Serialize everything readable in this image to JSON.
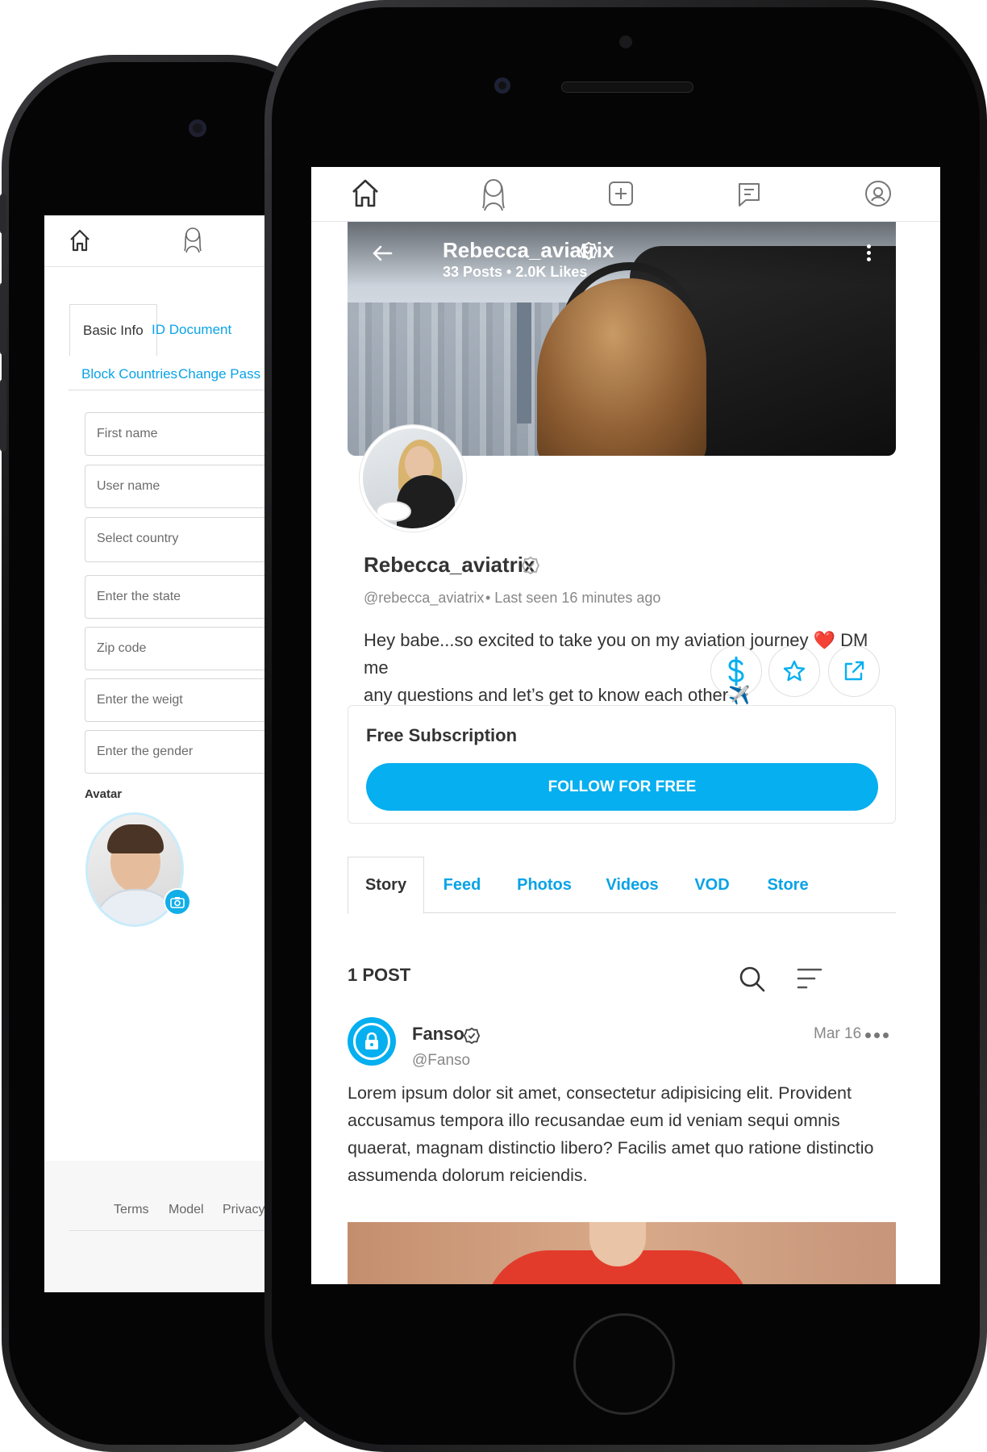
{
  "back_phone": {
    "tabs": [
      "Basic Info",
      "ID Document",
      "Block Countries",
      "Change Pass"
    ],
    "fields": [
      "First name",
      "User name",
      "Select country",
      "Enter the state",
      "Zip code",
      "Enter the weigt",
      "Enter the gender"
    ],
    "avatar_label": "Avatar",
    "footer_links": [
      "Terms",
      "Model",
      "Privacy P"
    ]
  },
  "front_phone": {
    "cover": {
      "name": "Rebecca_aviatrix",
      "stats": "33 Posts • 2.0K Likes"
    },
    "profile": {
      "name": "Rebecca_aviatrix",
      "handle": "@rebecca_aviatrix",
      "last_seen": "• Last seen 16 minutes ago",
      "bio_line1": "Hey babe...so excited to take you on my aviation journey ❤️ DM me",
      "bio_line2": "any questions and let’s get to know each other✈️"
    },
    "subscription": {
      "title": "Free Subscription",
      "button": "FOLLOW FOR FREE"
    },
    "tabs": [
      "Story",
      "Feed",
      "Photos",
      "Videos",
      "VOD",
      "Store"
    ],
    "post_count": "1 POST",
    "post": {
      "author": "Fanso",
      "handle": "@Fanso",
      "date": "Mar 16",
      "text": "Lorem ipsum dolor sit amet, consectetur adipisicing elit. Provident accusamus tempora illo recusandae eum id veniam sequi omnis quaerat, magnam distinctio libero? Facilis amet quo ratione distinctio assumenda dolorum reiciendis."
    },
    "accent_color": "#05aff0"
  }
}
